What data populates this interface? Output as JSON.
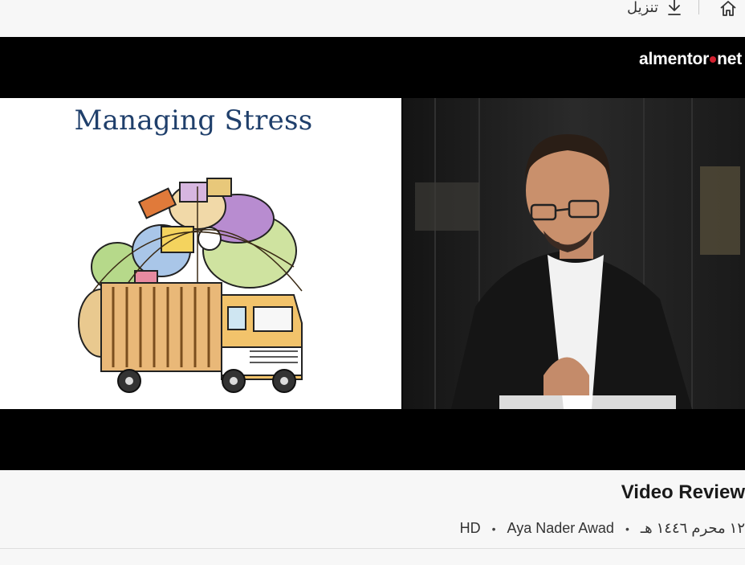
{
  "toolbar": {
    "download_label": "تنزيل",
    "download_icon": "download-icon",
    "home_icon": "home-icon"
  },
  "player": {
    "brand": {
      "left": "almentor",
      "right": "net"
    },
    "slide": {
      "title": "Managing Stress"
    }
  },
  "video": {
    "title": "Video Review",
    "quality": "HD",
    "author": "Aya Nader Awad",
    "date": "١٢ محرم ١٤٤٦ هـ"
  },
  "colors": {
    "accent": "#d2202f",
    "slide_title": "#1f3f6b"
  }
}
